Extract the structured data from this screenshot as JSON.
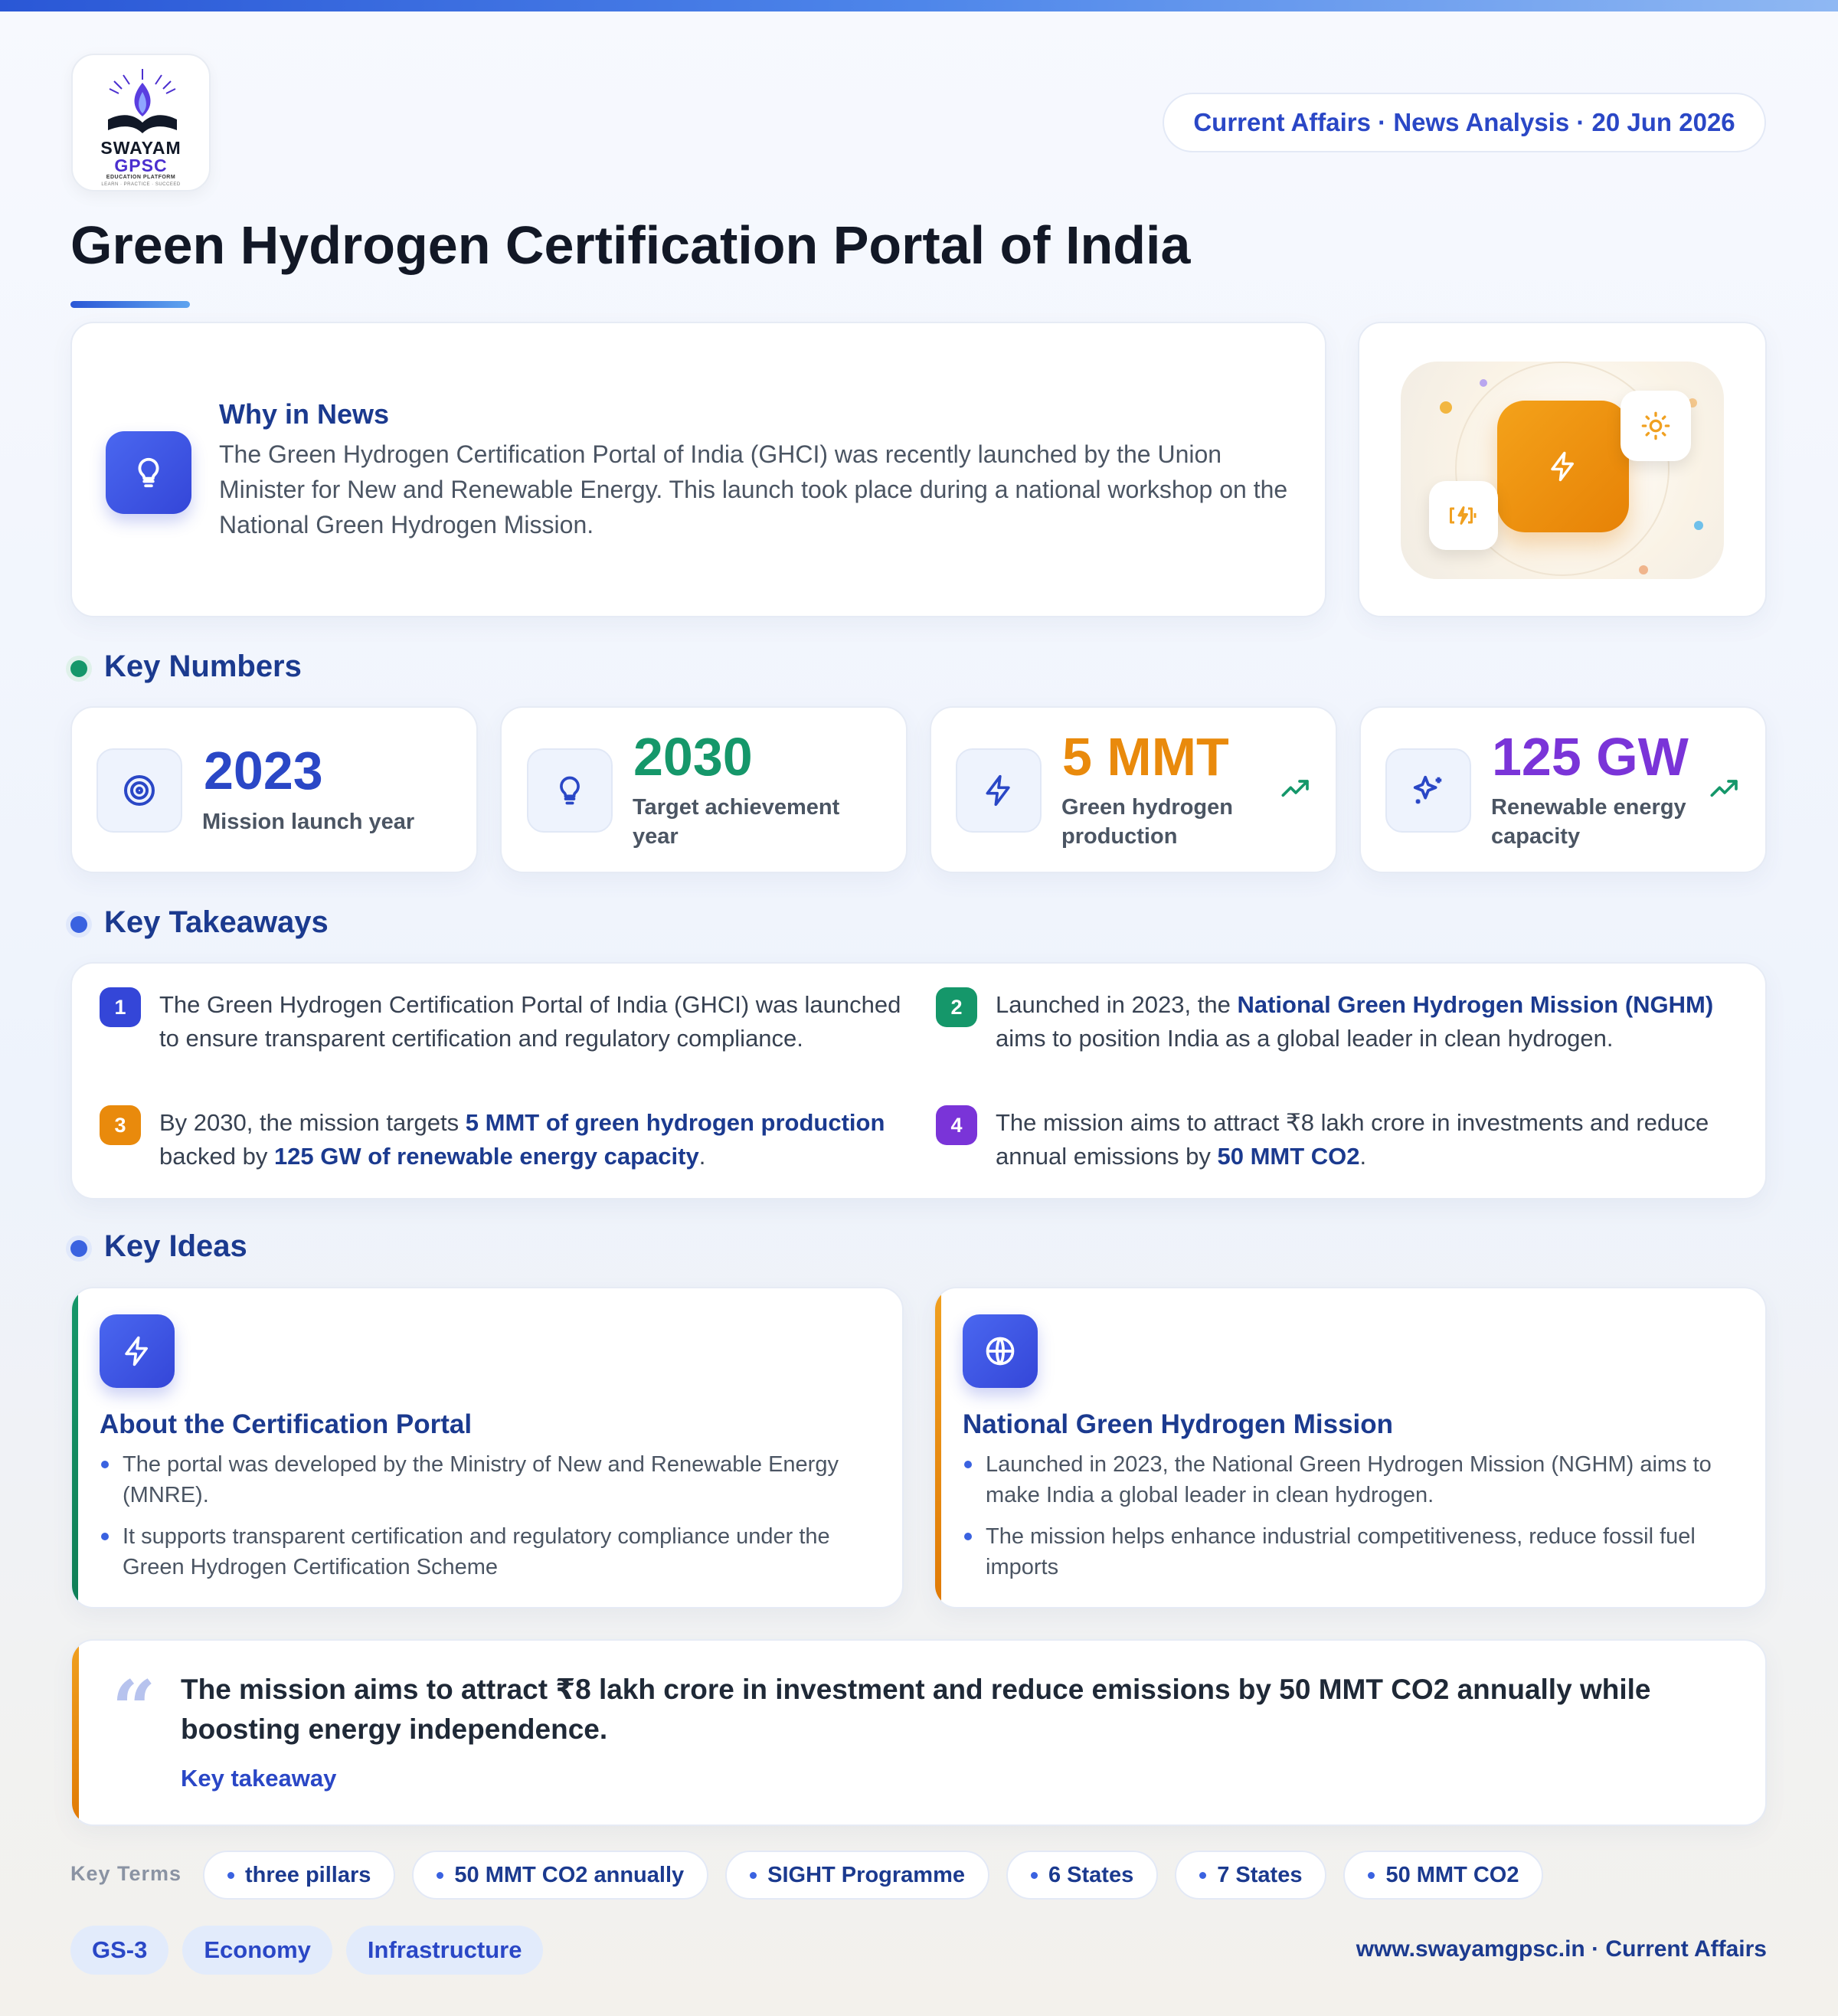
{
  "header": {
    "logo_line1": "SWAYAM",
    "logo_line2": "GPSC",
    "logo_line3": "EDUCATION PLATFORM",
    "logo_line4": "LEARN · PRACTICE · SUCCEED",
    "meta": "Current Affairs · News Analysis · 20 Jun 2026",
    "title": "Green Hydrogen Certification Portal of India"
  },
  "news": {
    "heading": "Why in News",
    "text": "The Green Hydrogen Certification Portal of India (GHCI) was recently launched by the Union Minister for New and Renewable Energy. This launch took place during a national workshop on the National Green Hydrogen Mission."
  },
  "sections": {
    "numbers": "Key Numbers",
    "takeaways": "Key Takeaways",
    "ideas": "Key Ideas"
  },
  "stats": [
    {
      "value": "2023",
      "label": "Mission launch year",
      "color": "#2a47c6",
      "icon": "target-icon"
    },
    {
      "value": "2030",
      "label": "Target achievement year",
      "color": "#15976a",
      "icon": "lightbulb-icon"
    },
    {
      "value": "5 MMT",
      "label": "Green hydrogen production",
      "color": "#e98a0c",
      "icon": "bolt-icon"
    },
    {
      "value": "125 GW",
      "label": "Renewable energy capacity",
      "color": "#7a34d8",
      "icon": "sparkle-icon"
    }
  ],
  "takeaways": [
    {
      "num": "1",
      "color": "#3446d8",
      "pre": "The Green Hydrogen Certification Portal of India (GHCI) was launched to ensure transparent certification and regulatory compliance.",
      "bold": "",
      "mid": "",
      "bold2": "",
      "post": ""
    },
    {
      "num": "2",
      "color": "#15976a",
      "pre": "Launched in 2023, the ",
      "bold": "National Green Hydrogen Mission (NGHM)",
      "mid": " aims to position India as a global leader in clean hydrogen.",
      "bold2": "",
      "post": ""
    },
    {
      "num": "3",
      "color": "#e98a0c",
      "pre": "By 2030, the mission targets ",
      "bold": "5 MMT of green hydrogen production",
      "mid": " backed by ",
      "bold2": "125 GW of renewable energy capacity",
      "post": "."
    },
    {
      "num": "4",
      "color": "#7a34d8",
      "pre": "The mission aims to attract ₹8 lakh crore in investments and reduce annual emissions by ",
      "bold": "50 MMT CO2",
      "mid": ".",
      "bold2": "",
      "post": ""
    }
  ],
  "ideas": [
    {
      "title": "About the Certification Portal",
      "stripe": "#15976a",
      "icon": "bolt-icon",
      "points": [
        "The portal was developed by the Ministry of New and Renewable Energy (MNRE).",
        "It supports transparent certification and regulatory compliance under the Green Hydrogen Certification Scheme"
      ]
    },
    {
      "title": "National Green Hydrogen Mission",
      "stripe": "#e98a0c",
      "icon": "globe-icon",
      "points": [
        "Launched in 2023, the National Green Hydrogen Mission (NGHM) aims to make India a global leader in clean hydrogen.",
        "The mission helps enhance industrial competitiveness, reduce fossil fuel imports"
      ]
    }
  ],
  "quote": {
    "mark": "“",
    "text": "The mission aims to attract ₹8 lakh crore in investment and reduce emissions by 50 MMT CO2 annually while boosting energy independence.",
    "label": "Key takeaway"
  },
  "key_terms": {
    "label": "Key Terms",
    "items": [
      "three pillars",
      "50 MMT CO2 annually",
      "SIGHT Programme",
      "6 States",
      "7 States",
      "50 MMT CO2"
    ]
  },
  "tags": [
    "GS-3",
    "Economy",
    "Infrastructure"
  ],
  "footer": "www.swayamgpsc.in · Current Affairs"
}
